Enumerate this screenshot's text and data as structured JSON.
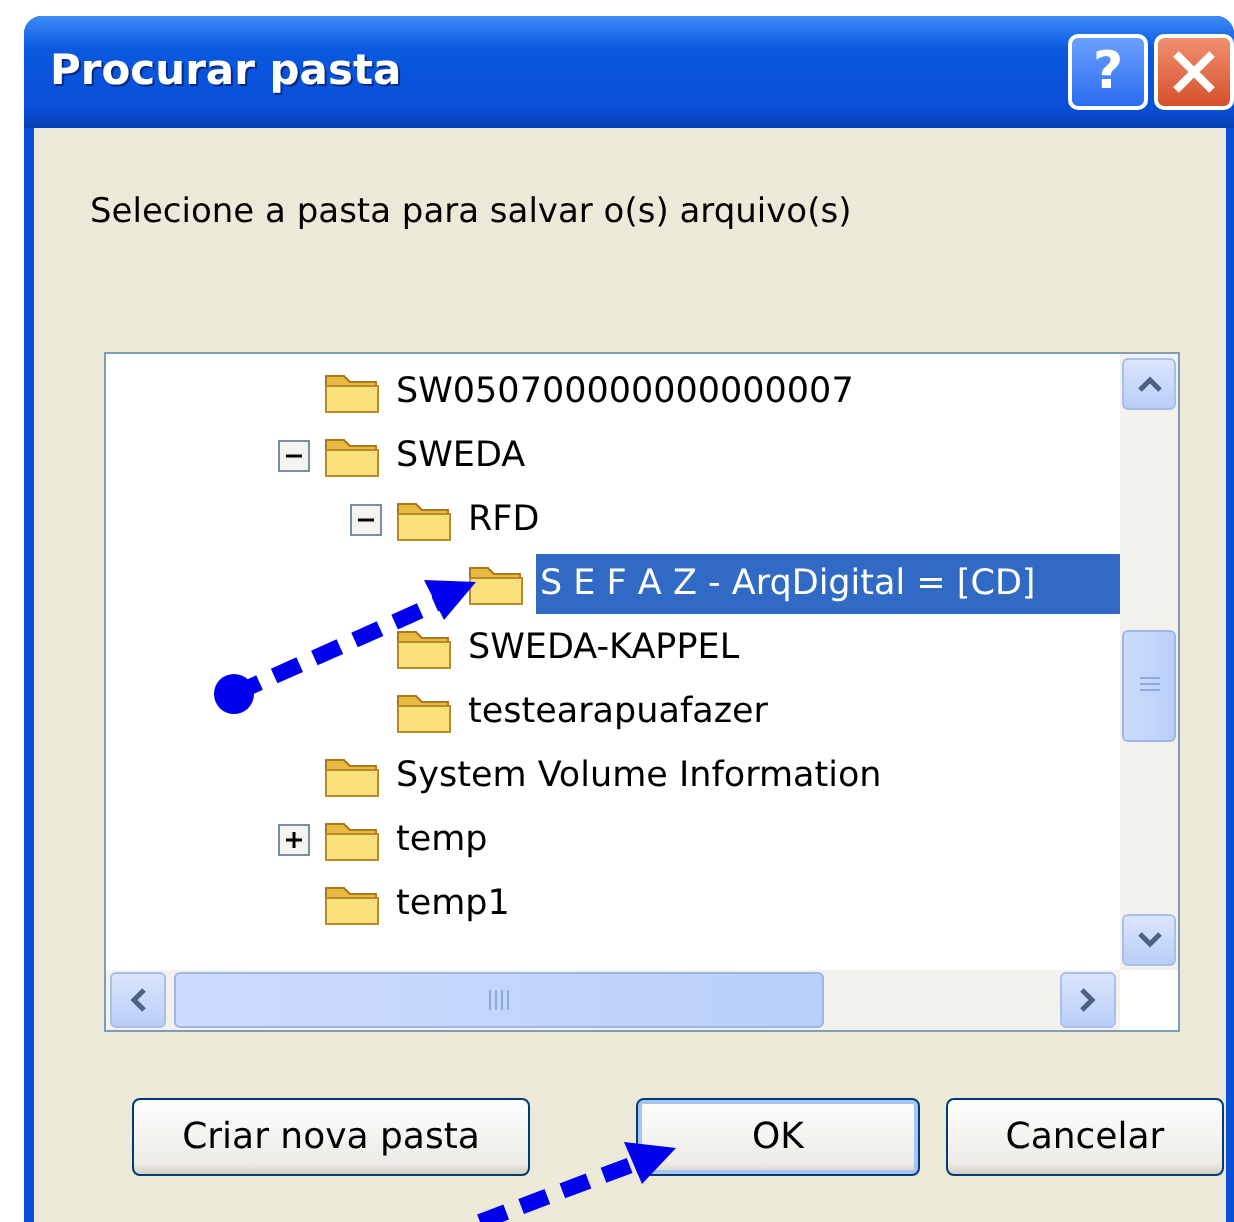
{
  "window": {
    "title": "Procurar pasta",
    "help_button": "?"
  },
  "prompt": "Selecione a pasta para salvar o(s) arquivo(s)",
  "tree": [
    {
      "label": "SW050700000000000007",
      "selected": false
    },
    {
      "label": "SWEDA",
      "selected": false,
      "expanded": true,
      "children": [
        {
          "label": "RFD",
          "selected": false,
          "expanded": true,
          "children": [
            {
              "label": "S E F A Z - ArqDigital = [CD]",
              "selected": true
            }
          ]
        },
        {
          "label": "SWEDA-KAPPEL",
          "selected": false
        },
        {
          "label": "testearapuafazer",
          "selected": false
        }
      ]
    },
    {
      "label": "System Volume Information",
      "selected": false
    },
    {
      "label": "temp",
      "selected": false,
      "expanded": false
    },
    {
      "label": "temp1",
      "selected": false
    }
  ],
  "buttons": [
    {
      "label": "Criar nova pasta",
      "default": false
    },
    {
      "label": "OK",
      "default": true
    },
    {
      "label": "Cancelar",
      "default": false
    }
  ]
}
